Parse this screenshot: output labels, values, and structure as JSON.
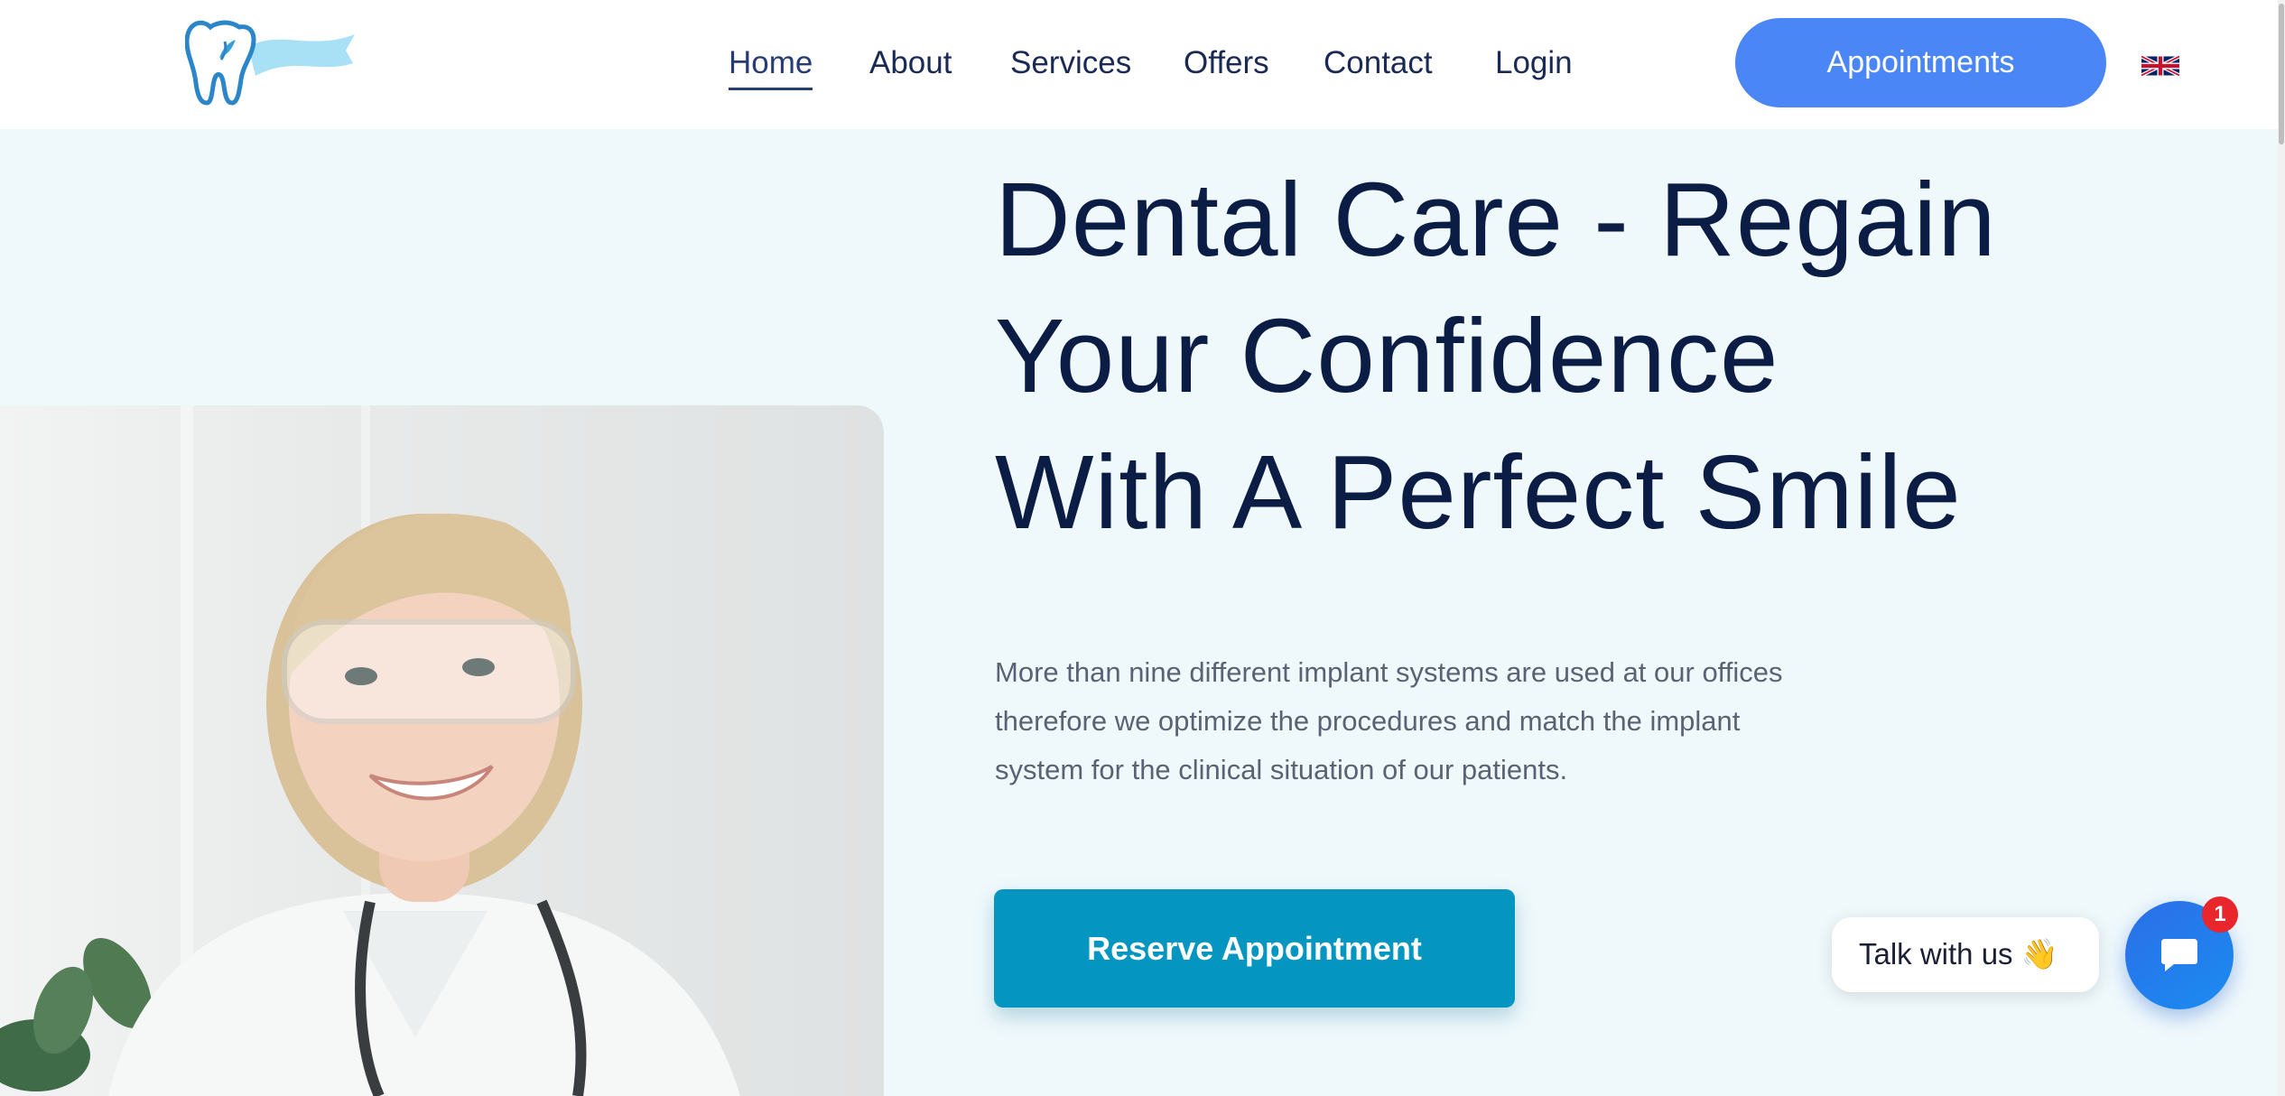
{
  "header": {
    "nav": [
      {
        "label": "Home",
        "active": true
      },
      {
        "label": "About",
        "active": false
      },
      {
        "label": "Services",
        "active": false
      },
      {
        "label": "Offers",
        "active": false
      },
      {
        "label": "Contact",
        "active": false
      },
      {
        "label": "Login",
        "active": false
      }
    ],
    "cta_label": "Appointments",
    "language_icon": "uk-flag-icon",
    "logo_icon": "tooth-logo-icon"
  },
  "hero": {
    "headline_lines": [
      "Dental Care - Regain",
      "Your Confidence",
      "With A Perfect Smile"
    ],
    "paragraph_lines": [
      "More than nine different implant systems are used at our offices",
      "therefore we optimize the procedures and match the implant",
      "system for the clinical situation of our patients."
    ],
    "button_label": "Reserve Appointment"
  },
  "chat": {
    "prompt": "Talk with us 👋",
    "badge": "1",
    "icon": "chat-bubble-icon"
  },
  "colors": {
    "primary": "#4a86f5",
    "reserve_button": "#0496c0",
    "heading": "#0b1c45",
    "hero_background": "#eff9fc",
    "badge": "#e8262c"
  }
}
